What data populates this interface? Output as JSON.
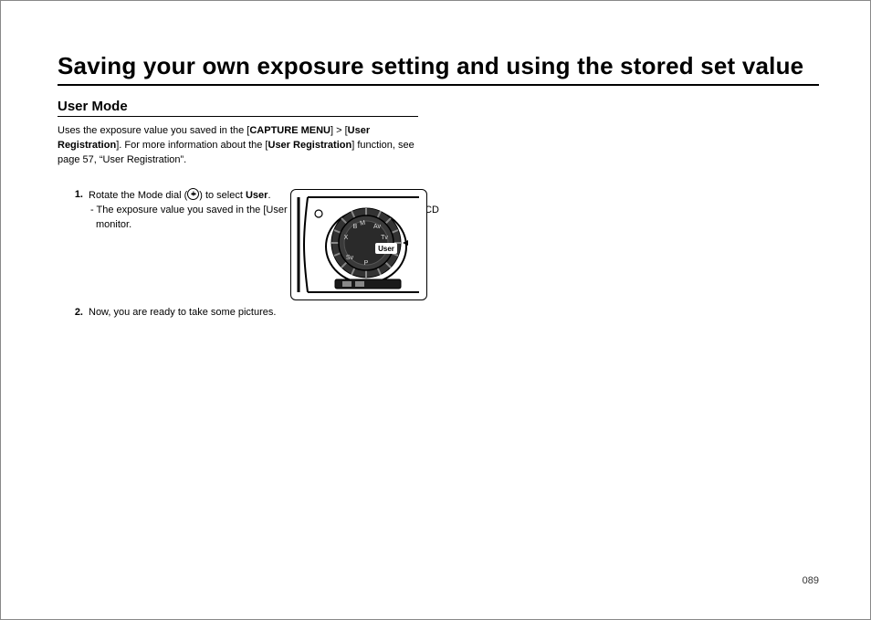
{
  "title": "Saving your own exposure setting and using the stored set value",
  "section": "User Mode",
  "intro": {
    "pre": "Uses the exposure value you saved in the [",
    "b1": "CAPTURE MENU",
    "mid1": "] > [",
    "b2": "User Registration",
    "mid2": "]. For more information about the [",
    "b3": "User Registration",
    "post": "] function, see page 57,   “User Registration”."
  },
  "steps": {
    "s1": {
      "num": "1.",
      "text_a": "Rotate the Mode dial (",
      "text_b": ") to select ",
      "bold": "User",
      "text_c": ".",
      "sub": "- The exposure value you saved in the [User Registration] appears on the LCD monitor."
    },
    "s2": {
      "num": "2.",
      "text": "Now, you are ready to take some pictures."
    }
  },
  "page_number": "089",
  "dial_label": "User"
}
